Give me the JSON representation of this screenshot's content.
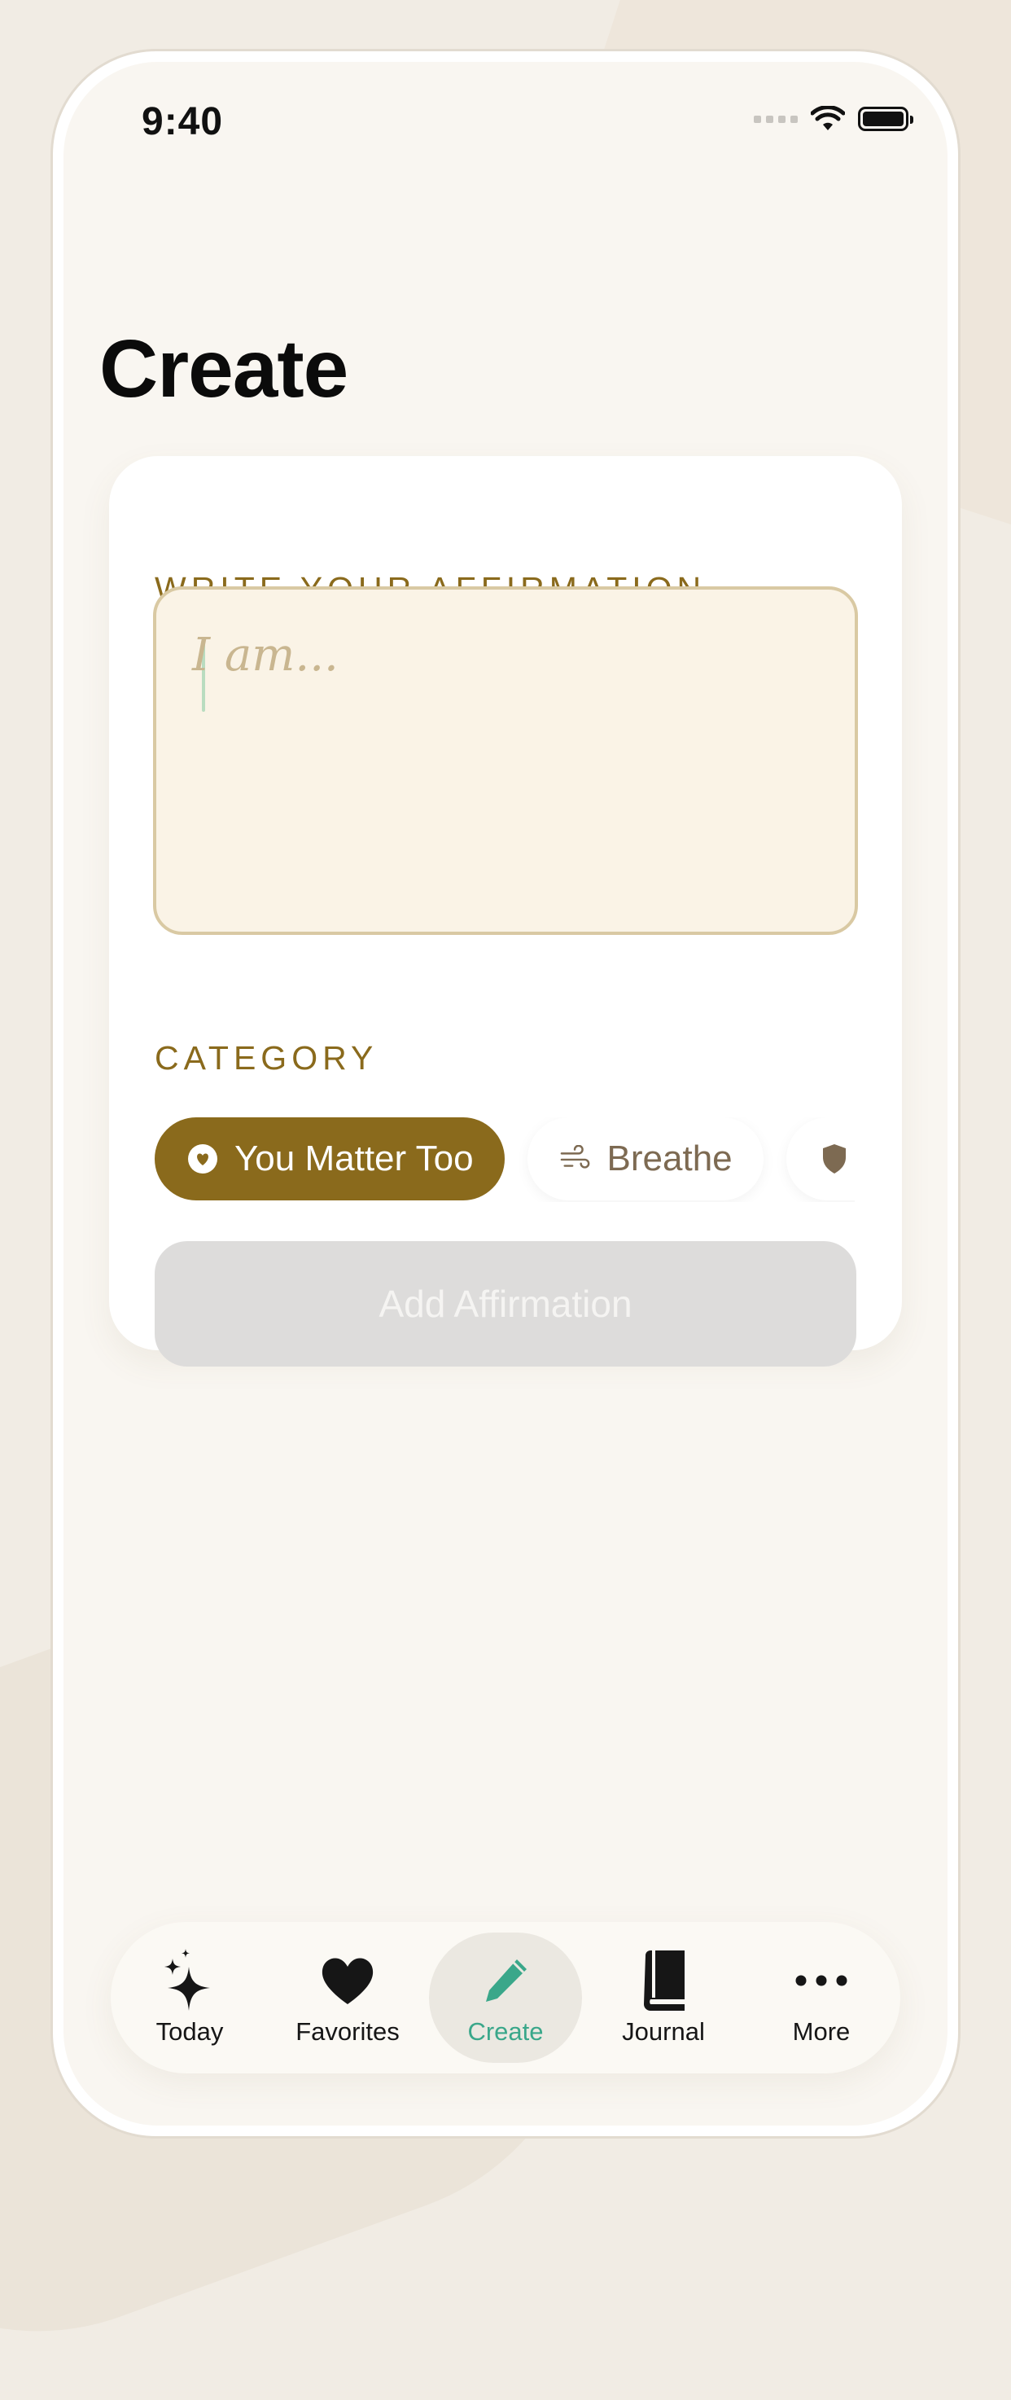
{
  "status_bar": {
    "time": "9:40"
  },
  "page": {
    "title": "Create"
  },
  "form": {
    "affirmation_label": "WRITE YOUR AFFIRMATION",
    "affirmation_placeholder": "I am...",
    "affirmation_value": "",
    "category_label": "CATEGORY",
    "categories": [
      {
        "label": "You Matter Too",
        "icon": "heart-circle-icon",
        "selected": true
      },
      {
        "label": "Breathe",
        "icon": "wind-icon",
        "selected": false
      },
      {
        "label": "",
        "icon": "shield-icon",
        "selected": false
      }
    ],
    "add_button_label": "Add Affirmation"
  },
  "tab_bar": {
    "tabs": [
      {
        "label": "Today",
        "icon": "sparkles-icon",
        "active": false
      },
      {
        "label": "Favorites",
        "icon": "heart-icon",
        "active": false
      },
      {
        "label": "Create",
        "icon": "pencil-icon",
        "active": true
      },
      {
        "label": "Journal",
        "icon": "book-icon",
        "active": false
      },
      {
        "label": "More",
        "icon": "ellipsis-icon",
        "active": false
      }
    ]
  },
  "colors": {
    "accent": "#8a6a1c",
    "active_tab": "#3aa78a",
    "background": "#f9f6f1",
    "textarea_bg": "#faf3e6",
    "disabled_button": "#dddcdb"
  }
}
